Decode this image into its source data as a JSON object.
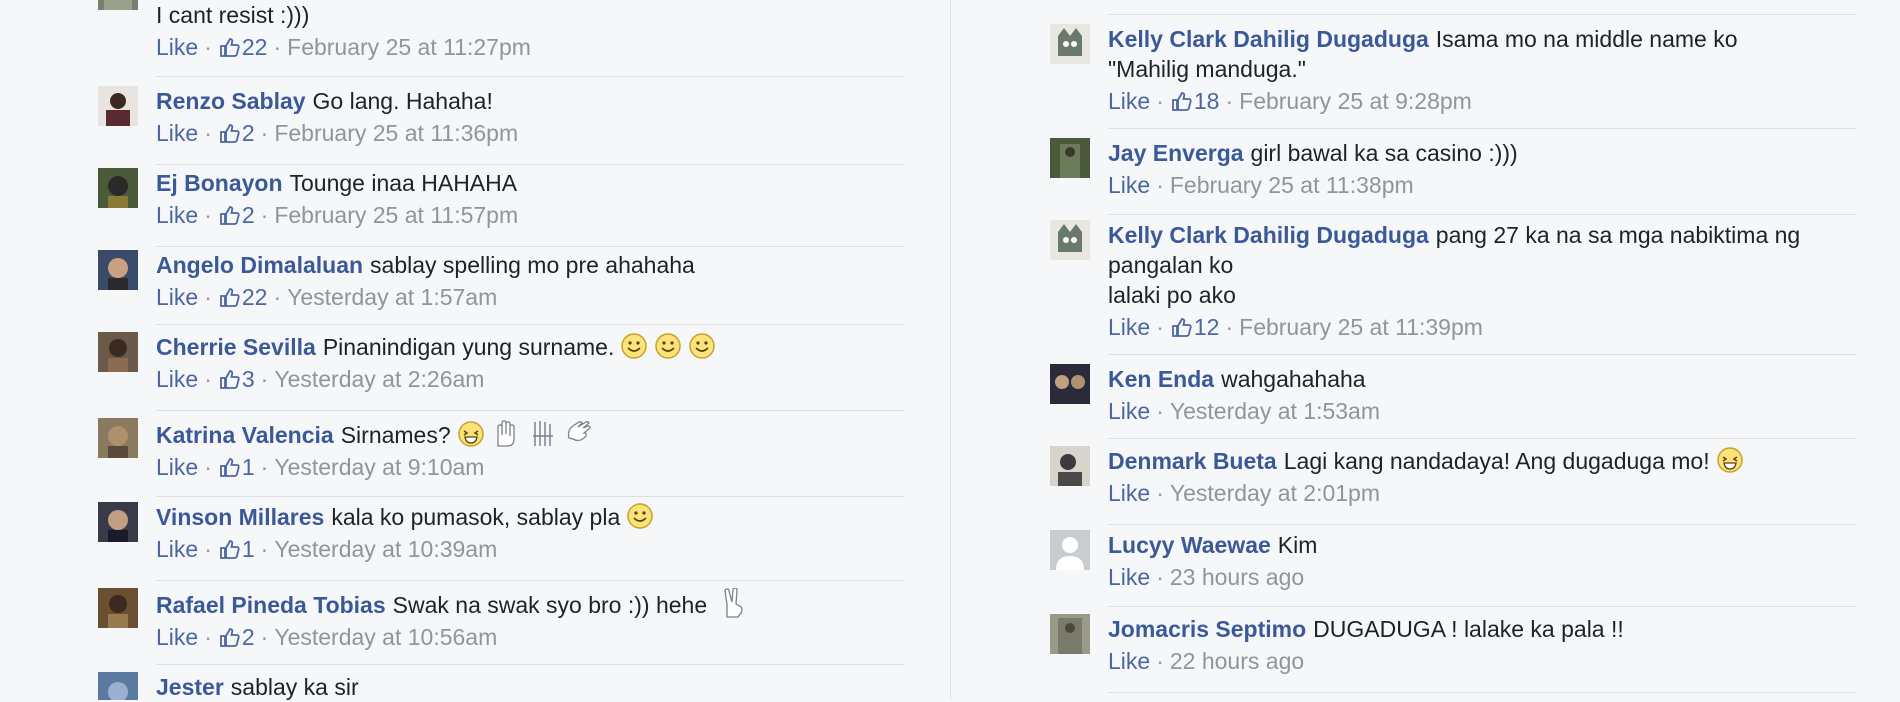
{
  "left_comments": [
    {
      "name": "",
      "text": "I cant resist :)))",
      "like": "Like",
      "likes": "22",
      "time": "February 25 at 11:27pm",
      "avatar_color": "#7a7f70"
    },
    {
      "name": "Renzo Sablay",
      "text": "Go lang. Hahaha!",
      "like": "Like",
      "likes": "2",
      "time": "February 25 at 11:36pm",
      "avatar_color": "#5a2a30"
    },
    {
      "name": "Ej Bonayon",
      "text": "Tounge inaa HAHAHA",
      "like": "Like",
      "likes": "2",
      "time": "February 25 at 11:57pm",
      "avatar_color": "#4a5a3a"
    },
    {
      "name": "Angelo Dimalaluan",
      "text": "sablay spelling mo pre ahahaha",
      "like": "Like",
      "likes": "22",
      "time": "Yesterday at 1:57am",
      "avatar_color": "#3a4a6a"
    },
    {
      "name": "Cherrie Sevilla",
      "text": "Pinanindigan yung surname.",
      "like": "Like",
      "likes": "3",
      "time": "Yesterday at 2:26am",
      "avatar_color": "#6a5a4a"
    },
    {
      "name": "Katrina Valencia",
      "text": "Sirnames?",
      "like": "Like",
      "likes": "1",
      "time": "Yesterday at 9:10am",
      "avatar_color": "#8a7a60"
    },
    {
      "name": "Vinson Millares",
      "text": "kala ko pumasok, sablay pla",
      "like": "Like",
      "likes": "1",
      "time": "Yesterday at 10:39am",
      "avatar_color": "#3a3a4a"
    },
    {
      "name": "Rafael Pineda Tobias",
      "text": "Swak na swak syo bro :)) hehe",
      "like": "Like",
      "likes": "2",
      "time": "Yesterday at 10:56am",
      "avatar_color": "#6a5030"
    },
    {
      "name": "Jester",
      "text": "sablay ka sir",
      "like": "",
      "likes": "",
      "time": "",
      "avatar_color": "#5a7aa0"
    }
  ],
  "right_comments": [
    {
      "name": "Kelly Clark Dahilig Dugaduga",
      "text_lines": [
        "Isama mo na middle name ko",
        "\"Mahilig manduga.\""
      ],
      "like": "Like",
      "likes": "18",
      "time": "February 25 at 9:28pm",
      "avatar_color": "#6a7a6a"
    },
    {
      "name": "Jay Enverga",
      "text_lines": [
        "girl bawal ka sa casino :)))"
      ],
      "like": "Like",
      "likes": "",
      "time": "February 25 at 11:38pm",
      "avatar_color": "#4a5a3a"
    },
    {
      "name": "Kelly Clark Dahilig Dugaduga",
      "text_lines": [
        "pang 27 ka na sa mga nabiktima ng",
        "pangalan ko",
        "lalaki po ako"
      ],
      "like": "Like",
      "likes": "12",
      "time": "February 25 at 11:39pm",
      "avatar_color": "#6a7a6a"
    },
    {
      "name": "Ken Enda",
      "text_lines": [
        "wahgahahaha"
      ],
      "like": "Like",
      "likes": "",
      "time": "Yesterday at 1:53am",
      "avatar_color": "#2a2a3a"
    },
    {
      "name": "Denmark Bueta",
      "text_lines": [
        "Lagi kang nandadaya! Ang dugaduga mo!"
      ],
      "like": "Like",
      "likes": "",
      "time": "Yesterday at 2:01pm",
      "avatar_color": "#4a4a4a"
    },
    {
      "name": "Lucyy Waewae",
      "text_lines": [
        "Kim"
      ],
      "like": "Like",
      "likes": "",
      "time": "23 hours ago",
      "avatar_color": "#c9ccd1"
    },
    {
      "name": "Jomacris Septimo",
      "text_lines": [
        "DUGADUGA ! lalake ka pala !!"
      ],
      "like": "Like",
      "likes": "",
      "time": "22 hours ago",
      "avatar_color": "#7a7a6a"
    }
  ]
}
